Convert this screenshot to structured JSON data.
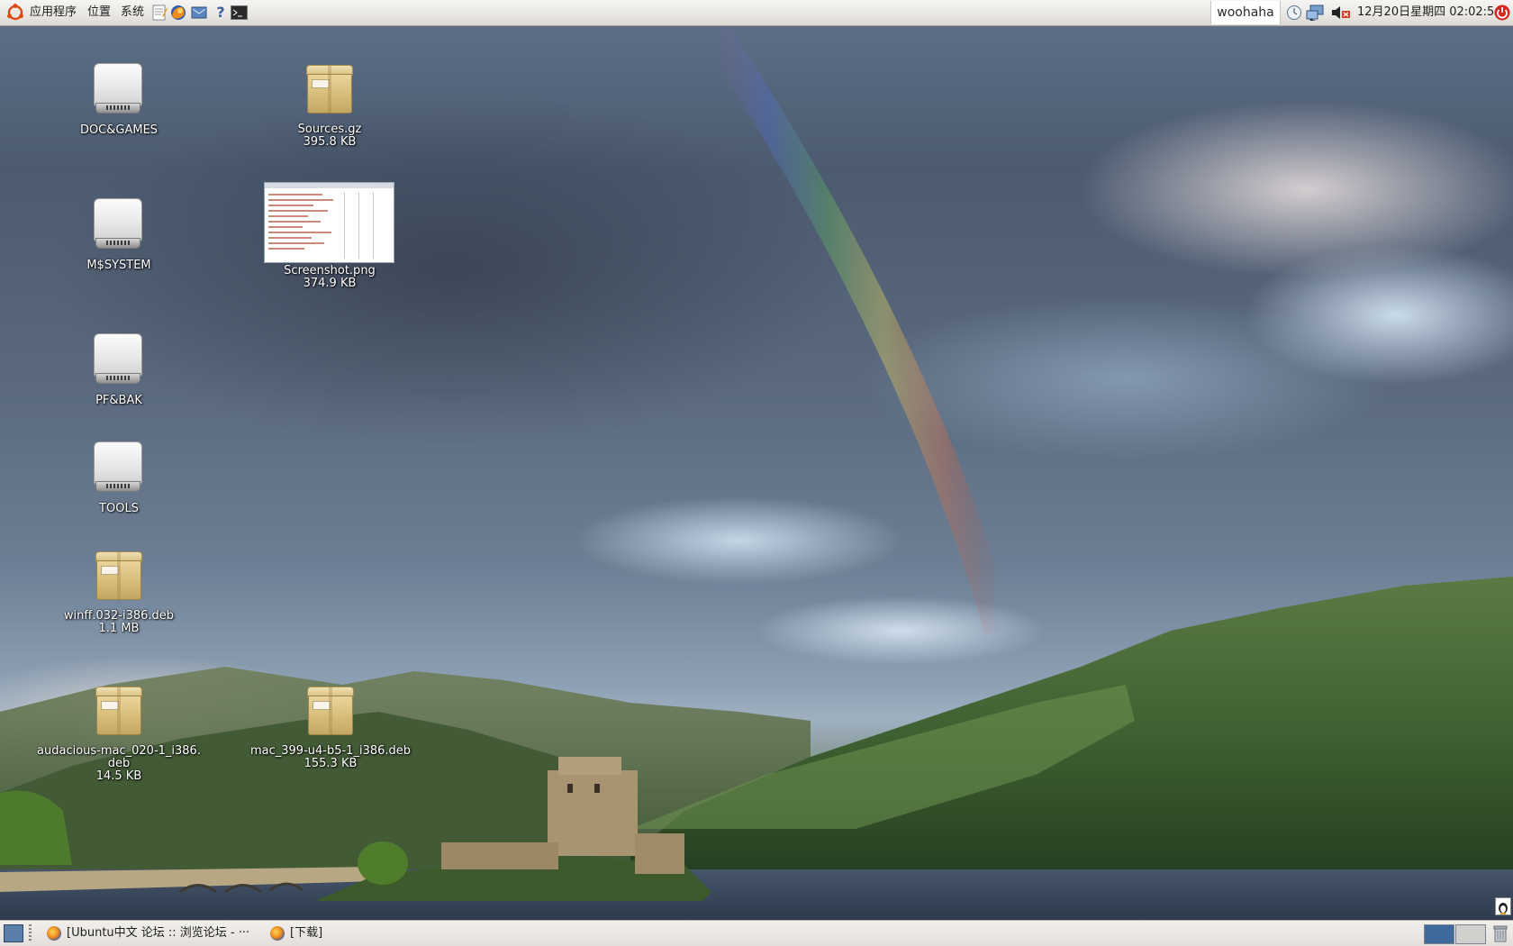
{
  "top_panel": {
    "menus": [
      "应用程序",
      "位置",
      "系统"
    ],
    "launchers": [
      "text-editor-icon",
      "firefox-icon",
      "mail-icon",
      "help-icon",
      "terminal-icon"
    ],
    "username": "woohaha",
    "clock": "12月20日星期四 02:02:54",
    "tray": [
      "clock-applet-icon",
      "network-icon",
      "volume-muted-icon",
      "power-icon"
    ]
  },
  "desktop_icons": [
    {
      "name": "DOC&GAMES",
      "type": "drive-icon"
    },
    {
      "name": "M$SYSTEM",
      "type": "drive-icon"
    },
    {
      "name": "PF&BAK",
      "type": "drive-icon"
    },
    {
      "name": "TOOLS",
      "type": "drive-icon"
    },
    {
      "name": "winff.032-i386.deb",
      "size": "1.1 MB",
      "type": "package-icon"
    },
    {
      "name_line1": "audacious-mac_020-1_i386.",
      "name_line2": "deb",
      "size": "14.5 KB",
      "type": "package-icon"
    },
    {
      "name": "Sources.gz",
      "size": "395.8 KB",
      "type": "package-icon"
    },
    {
      "name": "Screenshot.png",
      "size": "374.9 KB",
      "type": "image-thumbnail"
    },
    {
      "name": "mac_399-u4-b5-1_i386.deb",
      "size": "155.3 KB",
      "type": "package-icon"
    }
  ],
  "bottom_panel": {
    "tasks": [
      {
        "label": "[Ubuntu中文 论坛 :: 浏览论坛 - ···",
        "icon": "firefox-icon"
      },
      {
        "label": "[下载]",
        "icon": "firefox-icon"
      }
    ],
    "workspaces": 2,
    "active_workspace": 1
  },
  "colors": {
    "panel_bg": "#e9e7e3",
    "workspace_active": "#3f6a9c",
    "power_red": "#d8261e"
  }
}
